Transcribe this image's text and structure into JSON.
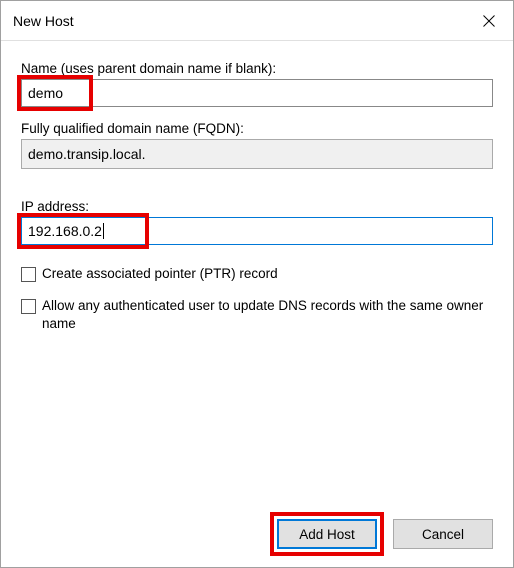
{
  "window": {
    "title": "New Host"
  },
  "fields": {
    "name": {
      "label": "Name (uses parent domain name if blank):",
      "value": "demo"
    },
    "fqdn": {
      "label": "Fully qualified domain name (FQDN):",
      "value": "demo.transip.local."
    },
    "ip": {
      "label": "IP address:",
      "value": "192.168.0.2"
    }
  },
  "checkboxes": {
    "ptr": {
      "label": "Create associated pointer (PTR) record",
      "checked": false
    },
    "allow": {
      "label": "Allow any authenticated user to update DNS records with the same owner name",
      "checked": false
    }
  },
  "buttons": {
    "addHost": "Add Host",
    "cancel": "Cancel"
  },
  "highlightColor": "#e60000"
}
